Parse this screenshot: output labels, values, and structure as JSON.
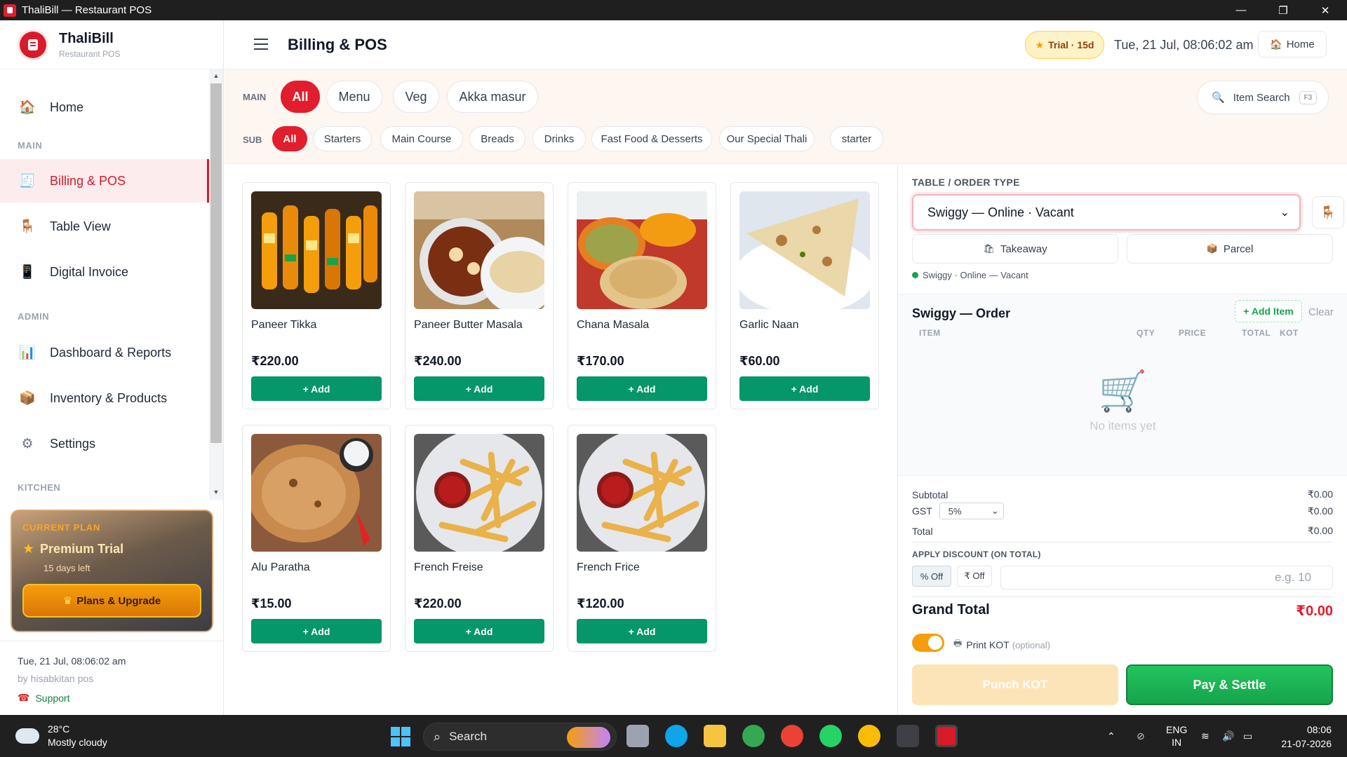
{
  "window": {
    "title": "ThaliBill — Restaurant POS",
    "min": "—",
    "max": "❐",
    "close": "✕"
  },
  "brand": {
    "name": "ThaliBill",
    "tagline": "Restaurant POS"
  },
  "sidebar": {
    "sections": {
      "main": "MAIN",
      "admin": "ADMIN",
      "kitchen": "KITCHEN"
    },
    "items": [
      {
        "label": "Home",
        "icon": "home-icon"
      },
      {
        "label": "Billing & POS",
        "icon": "receipt-icon"
      },
      {
        "label": "Table View",
        "icon": "chair-icon"
      },
      {
        "label": "Digital Invoice",
        "icon": "invoice-icon"
      },
      {
        "label": "Dashboard & Reports",
        "icon": "bar-chart-icon"
      },
      {
        "label": "Inventory & Products",
        "icon": "package-icon"
      },
      {
        "label": "Settings",
        "icon": "gear-icon"
      }
    ],
    "plan": {
      "heading": "CURRENT PLAN",
      "name": "Premium Trial",
      "days_left": "15 days left",
      "upgrade": "Plans & Upgrade"
    },
    "footer": {
      "datetime": "Tue, 21 Jul, 08:06:02 am",
      "by": "by hisabkitan pos",
      "support": "Support"
    }
  },
  "header": {
    "title": "Billing & POS",
    "trial": "Trial · 15d",
    "datetime": "Tue, 21 Jul, 08:06:02 am",
    "home": "Home"
  },
  "filters": {
    "main_label": "MAIN",
    "main": [
      "All",
      "Menu",
      "Veg",
      "Akka masur"
    ],
    "sub_label": "SUB",
    "sub": [
      "All",
      "Starters",
      "Main Course",
      "Breads",
      "Drinks",
      "Fast Food & Desserts",
      "Our Special Thali",
      "starter"
    ],
    "search_label": "Item Search",
    "search_key": "F3"
  },
  "products": [
    {
      "name": "Paneer Tikka",
      "price": "₹220.00",
      "add": "+ Add"
    },
    {
      "name": "Paneer Butter Masala",
      "price": "₹240.00",
      "add": "+ Add"
    },
    {
      "name": "Chana Masala",
      "price": "₹170.00",
      "add": "+ Add"
    },
    {
      "name": "Garlic Naan",
      "price": "₹60.00",
      "add": "+ Add"
    },
    {
      "name": "Alu Paratha",
      "price": "₹15.00",
      "add": "+ Add"
    },
    {
      "name": "French Freise",
      "price": "₹220.00",
      "add": "+ Add"
    },
    {
      "name": "French Frice",
      "price": "₹120.00",
      "add": "+ Add"
    }
  ],
  "order": {
    "table_label": "TABLE / ORDER TYPE",
    "table_value": "Swiggy — Online · Vacant",
    "takeaway": "Takeaway",
    "parcel": "Parcel",
    "status": "Swiggy · Online — Vacant",
    "title": "Swiggy — Order",
    "add_item": "+ Add Item",
    "clear": "Clear",
    "cols": {
      "item": "ITEM",
      "qty": "QTY",
      "price": "PRICE",
      "total": "TOTAL",
      "kot": "KOT"
    },
    "empty": "No items yet",
    "subtotal_label": "Subtotal",
    "subtotal": "₹0.00",
    "gst_label": "GST",
    "gst_rate": "5%",
    "gst": "₹0.00",
    "total_label": "Total",
    "total": "₹0.00",
    "discount_label": "APPLY DISCOUNT (ON TOTAL)",
    "pct_off": "% Off",
    "amt_off": "₹ Off",
    "discount_placeholder": "e.g. 10",
    "grand_label": "Grand Total",
    "grand": "₹0.00",
    "print_kot": "Print KOT",
    "optional": "(optional)",
    "print_kot_enabled": true,
    "punch": "Punch KOT",
    "pay": "Pay & Settle"
  },
  "taskbar": {
    "temp": "28°C",
    "weather": "Mostly cloudy",
    "search": "Search",
    "lang1": "ENG",
    "lang2": "IN",
    "time": "08:06",
    "date": "21-07-2026"
  }
}
